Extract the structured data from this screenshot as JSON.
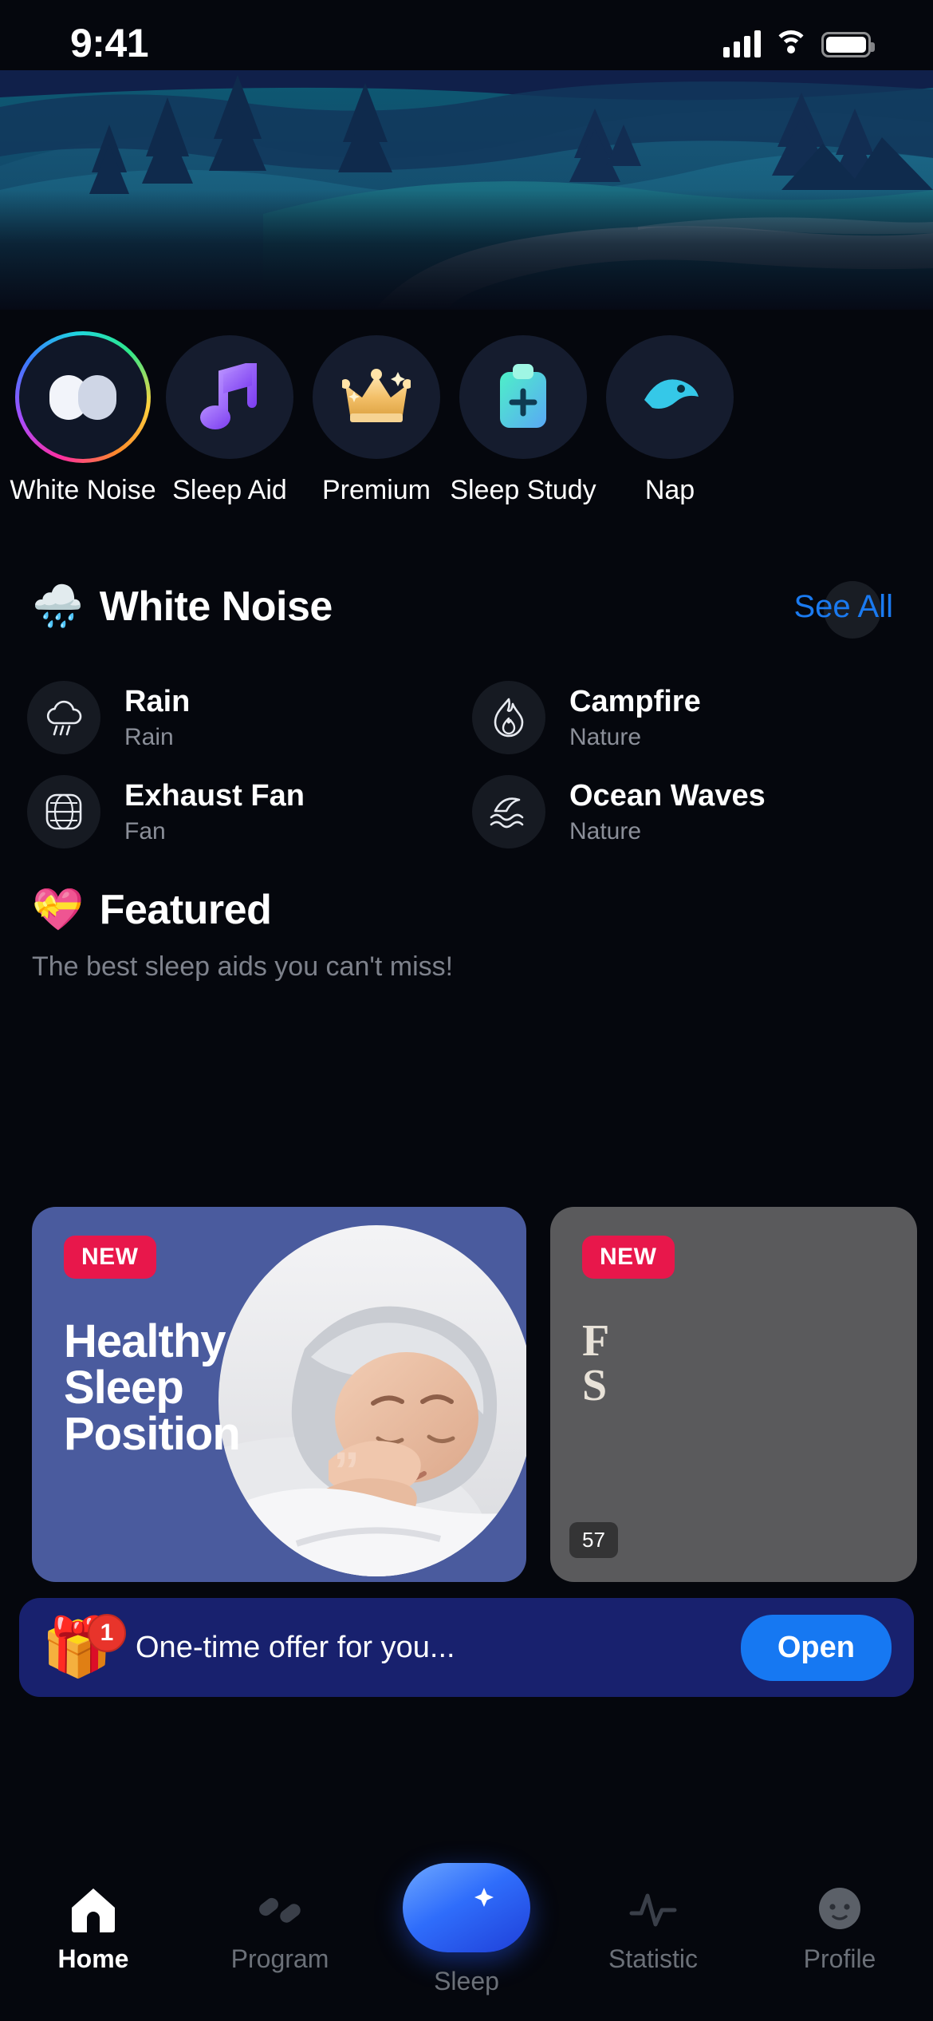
{
  "status_bar": {
    "time": "9:41",
    "icons": [
      "cellular-signal-icon",
      "wifi-icon",
      "battery-icon"
    ]
  },
  "hero": {
    "alt": "night-landscape-illustration"
  },
  "categories": [
    {
      "label": "White Noise",
      "icon": "white-noise-icon",
      "active": true
    },
    {
      "label": "Sleep Aid",
      "icon": "music-note-icon",
      "active": false
    },
    {
      "label": "Premium",
      "icon": "crown-icon",
      "active": false
    },
    {
      "label": "Sleep Study",
      "icon": "clipboard-plus-icon",
      "active": false
    },
    {
      "label": "Nap",
      "icon": "bird-icon",
      "active": false
    }
  ],
  "white_noise_section": {
    "emoji": "🌧️",
    "title": "White Noise",
    "see_all": "See All",
    "items": [
      {
        "name": "Rain",
        "category": "Rain",
        "icon": "rain-cloud-icon"
      },
      {
        "name": "Campfire",
        "category": "Nature",
        "icon": "flame-icon"
      },
      {
        "name": "Exhaust Fan",
        "category": "Fan",
        "icon": "fan-grille-icon"
      },
      {
        "name": "Ocean Waves",
        "category": "Nature",
        "icon": "ocean-wave-icon"
      }
    ]
  },
  "featured_section": {
    "emoji": "💝",
    "title": "Featured",
    "subtitle": "The best sleep aids you can't miss!",
    "cards": [
      {
        "badge": "NEW",
        "title": "Healthy\nSleep\nPosition",
        "quote": "”",
        "duration": ""
      },
      {
        "badge": "NEW",
        "title": "F\nS",
        "duration": "57"
      }
    ]
  },
  "offer_banner": {
    "emoji": "🎁",
    "count": "1",
    "text": "One-time offer for you...",
    "button": "Open"
  },
  "tab_bar": {
    "items": [
      {
        "label": "Home",
        "icon": "home-icon",
        "active": true
      },
      {
        "label": "Program",
        "icon": "program-icon",
        "active": false
      },
      {
        "label": "Sleep",
        "icon": "moon-star-icon",
        "active": false,
        "fab": true
      },
      {
        "label": "Statistic",
        "icon": "pulse-icon",
        "active": false
      },
      {
        "label": "Profile",
        "icon": "profile-avatar-icon",
        "active": false
      }
    ]
  },
  "colors": {
    "background": "#05070d",
    "accent_blue": "#1678f2",
    "link_blue": "#1a7af0",
    "badge_red": "#e8174b",
    "card_blue": "#4a5b9e",
    "offer_navy": "#18216e"
  }
}
